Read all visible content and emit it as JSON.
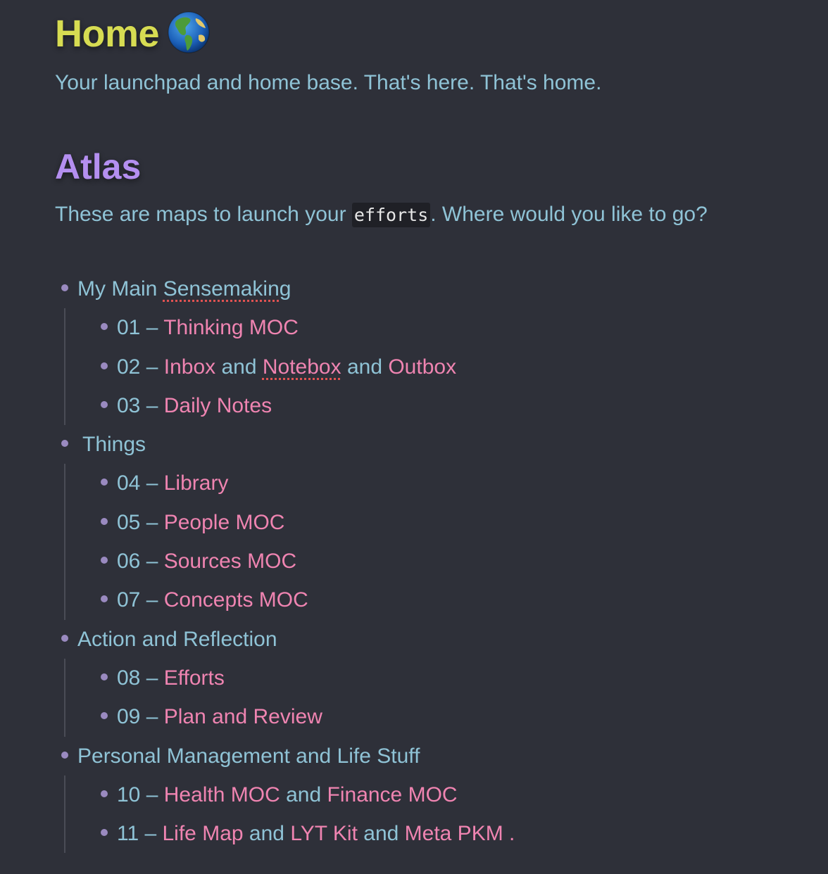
{
  "home": {
    "title": "Home",
    "description": "Your launchpad and home base. That's here. That's home."
  },
  "atlas": {
    "title": "Atlas",
    "desc_before": "These are maps to launch your ",
    "desc_code": "efforts",
    "desc_after": ". Where would you like to go?"
  },
  "groups": [
    {
      "label_prefix": "My Main ",
      "label_misspelled": "Sensemaking",
      "items": [
        {
          "prefix": "01 – ",
          "link1": "Thinking MOC"
        },
        {
          "prefix": "02 – ",
          "link1": "Inbox",
          "sep1": " and ",
          "link2": "Notebox",
          "sep2": " and ",
          "link3": "Outbox"
        },
        {
          "prefix": "03 – ",
          "link1": "Daily Notes"
        }
      ]
    },
    {
      "label": "Things",
      "items": [
        {
          "prefix": "04 – ",
          "link1": "Library"
        },
        {
          "prefix": "05 – ",
          "link1": "People MOC"
        },
        {
          "prefix": "06 – ",
          "link1": "Sources MOC"
        },
        {
          "prefix": "07 – ",
          "link1": "Concepts MOC"
        }
      ]
    },
    {
      "label": "Action and Reflection",
      "items": [
        {
          "prefix": "08 – ",
          "link1": "Efforts"
        },
        {
          "prefix": "09 – ",
          "link1": "Plan and Review"
        }
      ]
    },
    {
      "label": "Personal Management and Life Stuff",
      "items": [
        {
          "prefix": "10 – ",
          "link1": "Health MOC",
          "sep1": " and ",
          "link2": "Finance MOC"
        },
        {
          "prefix": "11 – ",
          "link1": "Life Map",
          "sep1": " and ",
          "link2": "LYT Kit",
          "sep2": " and ",
          "link3": "Meta PKM",
          "suffix": " ."
        }
      ]
    }
  ],
  "colors": {
    "background": "#2e3039",
    "home_title": "#d7dc52",
    "atlas_title": "#b48ff0",
    "text": "#8fc3d6",
    "link": "#ef84b1"
  },
  "icons": {
    "home_emoji": "globe-americas-icon"
  }
}
